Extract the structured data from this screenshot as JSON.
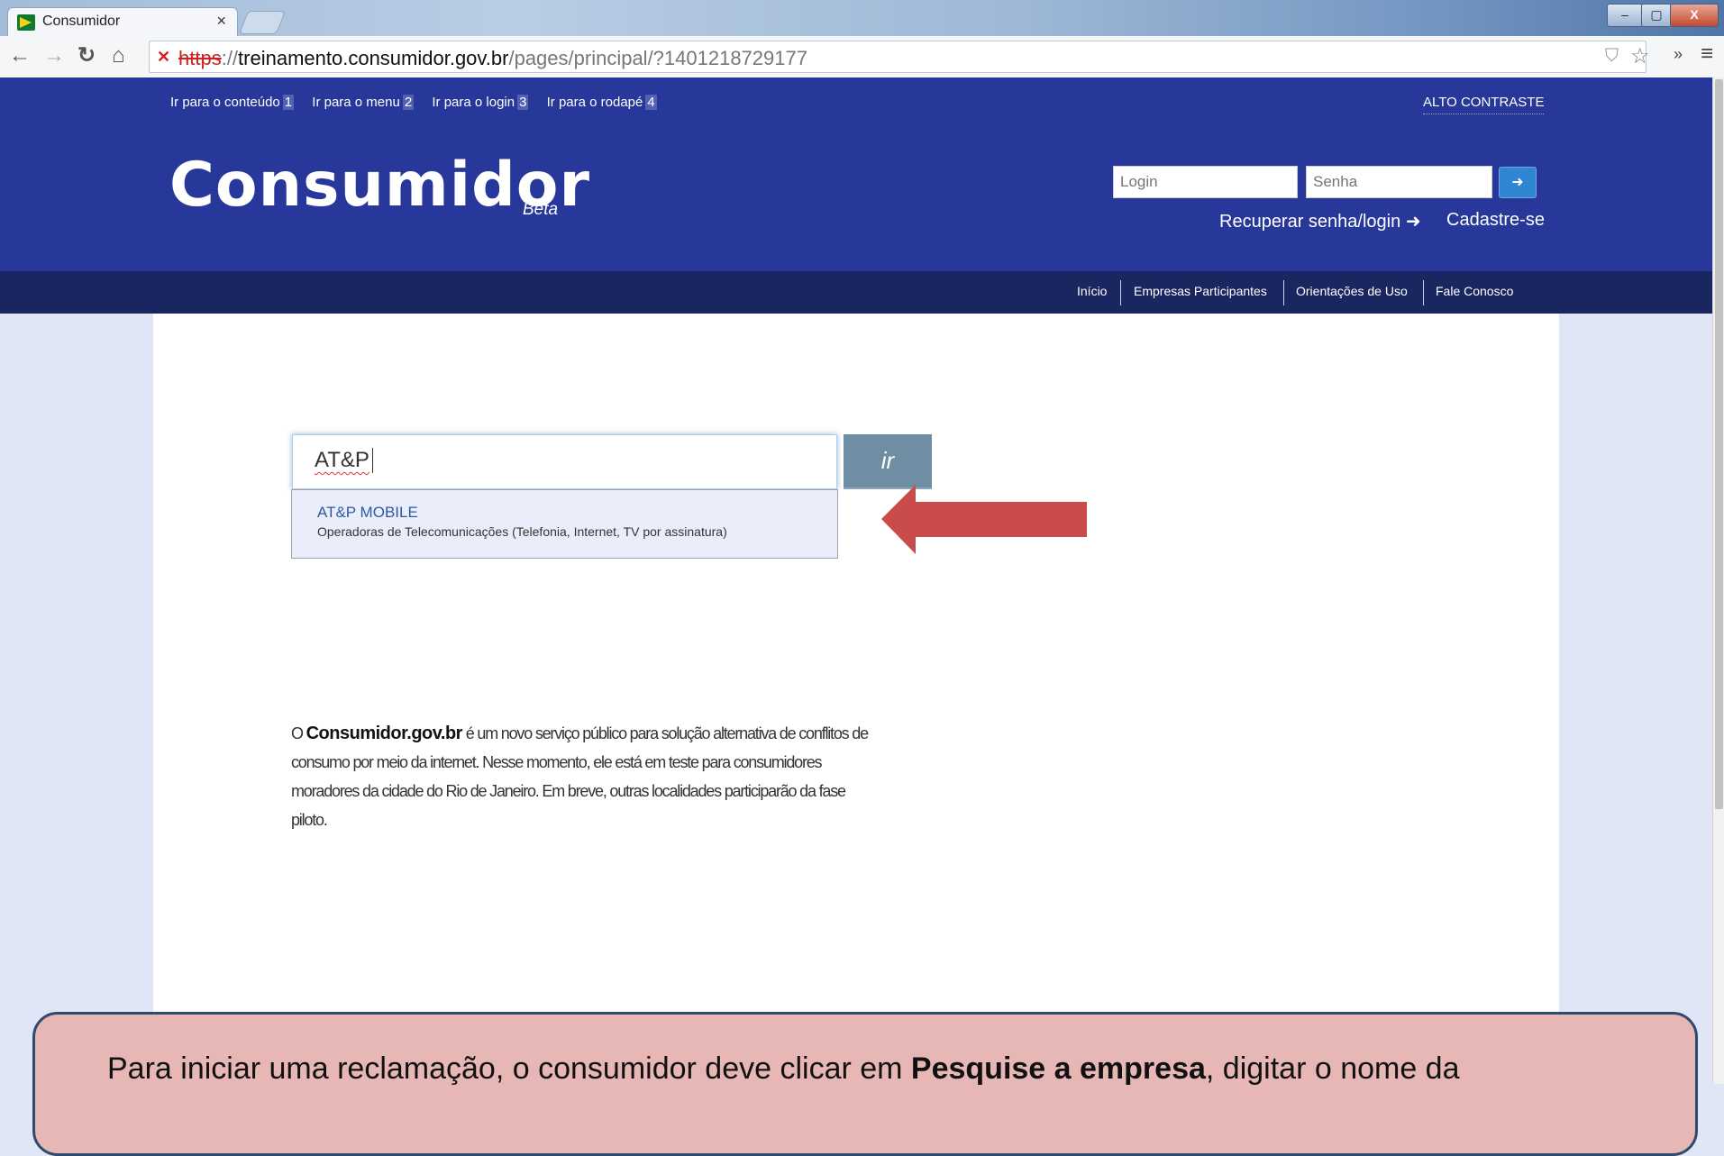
{
  "browser": {
    "tab_title": "Consumidor",
    "tab_close": "×",
    "url_protocol": "https",
    "url_host": "treinamento.consumidor.gov.br",
    "url_path": "/pages/principal/?1401218729177",
    "more_extensions": "»",
    "window_controls": {
      "minimize": "–",
      "maximize": "▢",
      "close": "X"
    }
  },
  "header": {
    "skip_links": [
      {
        "label": "Ir para o conteúdo",
        "key": "1"
      },
      {
        "label": "Ir para o menu",
        "key": "2"
      },
      {
        "label": "Ir para o login",
        "key": "3"
      },
      {
        "label": "Ir para o rodapé",
        "key": "4"
      }
    ],
    "high_contrast": "ALTO CONTRASTE",
    "logo": "Consumidor",
    "logo_beta": "Beta",
    "login_placeholder": "Login",
    "password_placeholder": "Senha",
    "recover_link": "Recuperar senha/login",
    "signup_link": "Cadastre-se"
  },
  "nav": {
    "items": [
      "Início",
      "Empresas Participantes",
      "Orientações de Uso",
      "Fale Conosco"
    ]
  },
  "search": {
    "value": "AT&P",
    "go_label": "ir",
    "suggestion": {
      "name": "AT&P MOBILE",
      "category": "Operadoras de Telecomunicações (Telefonia, Internet, TV por assinatura)"
    }
  },
  "about": {
    "prefix": "O ",
    "brand": "Consumidor.gov.br",
    "text": " é um novo serviço público para solução alternativa de conflitos de consumo por meio da internet. Nesse momento, ele está em teste para consumidores moradores da cidade do Rio de Janeiro. Em breve, outras localidades participarão da fase piloto."
  },
  "callout": {
    "before": "Para iniciar uma reclamação, o consumidor deve clicar em ",
    "bold": "Pesquise a empresa",
    "after": ", digitar o nome da"
  },
  "colors": {
    "header_bg": "#27379a",
    "nav_bg": "#1a2660",
    "page_bg": "#e1e6f6",
    "arrow": "#c94b4b",
    "callout_bg": "#e7b7b6"
  }
}
